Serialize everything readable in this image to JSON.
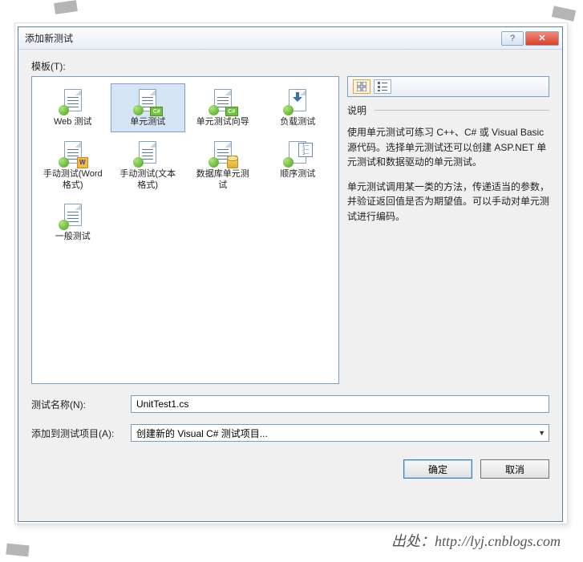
{
  "titlebar": {
    "title": "添加新测试"
  },
  "templates_label": "模板(T):",
  "templates": [
    {
      "id": "web",
      "label": "Web 测试"
    },
    {
      "id": "unit",
      "label": "单元测试",
      "selected": true
    },
    {
      "id": "unit-wizard",
      "label": "单元测试向导"
    },
    {
      "id": "load",
      "label": "负载测试"
    },
    {
      "id": "manual-word",
      "label": "手动测试(Word 格式)"
    },
    {
      "id": "manual-text",
      "label": "手动测试(文本格式)"
    },
    {
      "id": "db-unit",
      "label": "数据库单元测试"
    },
    {
      "id": "ordered",
      "label": "顺序测试"
    },
    {
      "id": "generic",
      "label": "一般测试"
    }
  ],
  "description": {
    "heading": "说明",
    "para1": "使用单元测试可练习 C++、C# 或 Visual Basic 源代码。选择单元测试还可以创建 ASP.NET 单元测试和数据驱动的单元测试。",
    "para2": "单元测试调用某一类的方法，传递适当的参数，并验证返回值是否为期望值。可以手动对单元测试进行编码。"
  },
  "form": {
    "name_label": "测试名称(N):",
    "name_value": "UnitTest1.cs",
    "project_label": "添加到测试项目(A):",
    "project_value": "创建新的 Visual C# 测试项目..."
  },
  "buttons": {
    "ok": "确定",
    "cancel": "取消"
  },
  "attribution": "出处：http://lyj.cnblogs.com"
}
